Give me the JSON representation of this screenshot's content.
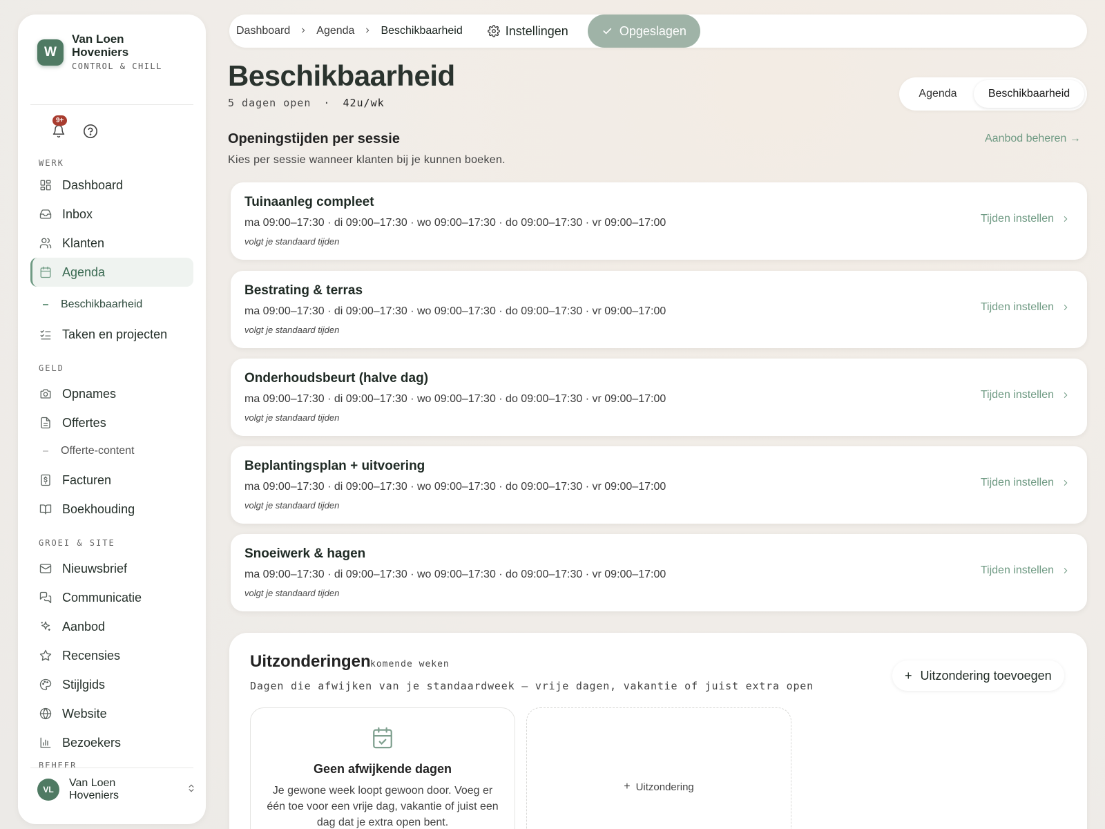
{
  "brand": {
    "logo_letter": "W",
    "name": "Van Loen Hoveniers",
    "tagline": "CONTROL & CHILL",
    "accent_color": "#4f7a63"
  },
  "notifications": {
    "badge": "9+"
  },
  "sidebar": {
    "sections": {
      "werk": "WERK",
      "geld": "GELD",
      "groei": "GROEI & SITE",
      "beheer": "BEHEER"
    },
    "items": {
      "dashboard": "Dashboard",
      "inbox": "Inbox",
      "klanten": "Klanten",
      "agenda": "Agenda",
      "beschikbaarheid": "Beschikbaarheid",
      "taken": "Taken en projecten",
      "opnames": "Opnames",
      "offertes": "Offertes",
      "offerte_content": "Offerte-content",
      "facturen": "Facturen",
      "boekhouding": "Boekhouding",
      "nieuwsbrief": "Nieuwsbrief",
      "communicatie": "Communicatie",
      "aanbod": "Aanbod",
      "recensies": "Recensies",
      "stijlgids": "Stijlgids",
      "website": "Website",
      "bezoekers": "Bezoekers"
    },
    "user": {
      "initials": "VL",
      "name": "Van Loen Hoveniers"
    }
  },
  "breadcrumb": {
    "items": [
      "Dashboard",
      "Agenda",
      "Beschikbaarheid"
    ]
  },
  "topbar": {
    "settings_label": "Instellingen",
    "saved_label": "Opgeslagen"
  },
  "header": {
    "title": "Beschikbaarheid",
    "days_open": "5 dagen open",
    "separator": "·",
    "hours": "42u/wk",
    "view_toggle": [
      "Agenda",
      "Beschikbaarheid"
    ]
  },
  "sessions_section": {
    "title": "Openingstijden per sessie",
    "description": "Kies per sessie wanneer klanten bij je kunnen boeken.",
    "manage_link": "Aanbod beheren →"
  },
  "sessions": [
    {
      "name": "Tuinaanleg compleet",
      "times": "ma 09:00–17:30 · di 09:00–17:30 · wo 09:00–17:30 · do 09:00–17:30 · vr 09:00–17:00",
      "note": "volgt je standaard tijden",
      "action": "Tijden instellen"
    },
    {
      "name": "Bestrating & terras",
      "times": "ma 09:00–17:30 · di 09:00–17:30 · wo 09:00–17:30 · do 09:00–17:30 · vr 09:00–17:00",
      "note": "volgt je standaard tijden",
      "action": "Tijden instellen"
    },
    {
      "name": "Onderhoudsbeurt (halve dag)",
      "times": "ma 09:00–17:30 · di 09:00–17:30 · wo 09:00–17:30 · do 09:00–17:30 · vr 09:00–17:00",
      "note": "volgt je standaard tijden",
      "action": "Tijden instellen"
    },
    {
      "name": "Beplantingsplan + uitvoering",
      "times": "ma 09:00–17:30 · di 09:00–17:30 · wo 09:00–17:30 · do 09:00–17:30 · vr 09:00–17:00",
      "note": "volgt je standaard tijden",
      "action": "Tijden instellen"
    },
    {
      "name": "Snoeiwerk & hagen",
      "times": "ma 09:00–17:30 · di 09:00–17:30 · wo 09:00–17:30 · do 09:00–17:30 · vr 09:00–17:00",
      "note": "volgt je standaard tijden",
      "action": "Tijden instellen"
    }
  ],
  "exceptions": {
    "title": "Uitzonderingen",
    "badge": "komende weken",
    "description": "Dagen die afwijken van je standaardweek — vrije dagen, vakantie of juist extra open",
    "add_button": "Uitzondering toevoegen",
    "empty_title": "Geen afwijkende dagen",
    "empty_description": "Je gewone week loopt gewoon door. Voeg er één toe voor een vrije dag, vakantie of juist een dag dat je extra open bent.",
    "add_card_label": "Uitzondering"
  }
}
